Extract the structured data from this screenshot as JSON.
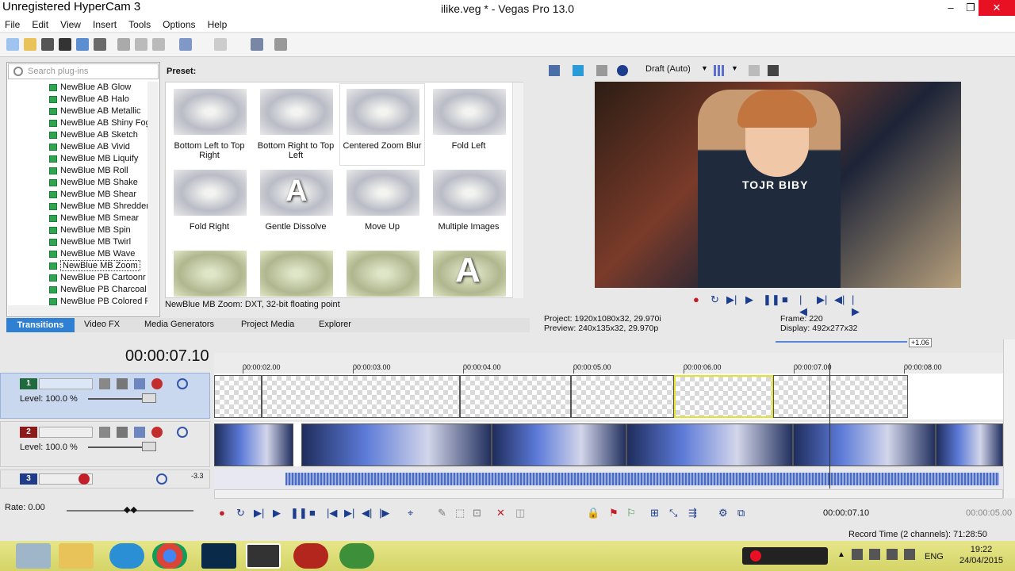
{
  "watermark": "Unregistered HyperCam 3",
  "window": {
    "title": "ilike.veg * - Vegas Pro 13.0",
    "min": "–",
    "max": "❐",
    "close": "✕"
  },
  "menu": [
    "File",
    "Edit",
    "View",
    "Insert",
    "Tools",
    "Options",
    "Help"
  ],
  "search": {
    "placeholder": "Search plug-ins"
  },
  "tree": [
    "NewBlue AB Glow",
    "NewBlue AB Halo",
    "NewBlue AB Metallic",
    "NewBlue AB Shiny Fog",
    "NewBlue AB Sketch",
    "NewBlue AB Vivid",
    "NewBlue MB Liquify",
    "NewBlue MB Roll",
    "NewBlue MB Shake",
    "NewBlue MB Shear",
    "NewBlue MB Shredder",
    "NewBlue MB Smear",
    "NewBlue MB Spin",
    "NewBlue MB Twirl",
    "NewBlue MB Wave",
    "NewBlue MB Zoom",
    "NewBlue PB Cartoonr",
    "NewBlue PB Charcoal",
    "NewBlue PB Colored Pen"
  ],
  "preset_label": "Preset:",
  "presets": [
    "Bottom Left to Top Right",
    "Bottom Right to Top Left",
    "Centered Zoom Blur",
    "Fold Left",
    "Fold Right",
    "Gentle Dissolve",
    "Move Up",
    "Multiple Images"
  ],
  "preset_row3_letter": "A",
  "status": "NewBlue MB Zoom: DXT, 32-bit floating point",
  "tabs": [
    "Transitions",
    "Video FX",
    "Media Generators",
    "Project Media",
    "Explorer"
  ],
  "preview": {
    "quality": "Draft (Auto)",
    "overlay_text": "TOJR BIBY",
    "project": "Project:",
    "project_val": "1920x1080x32, 29.970i",
    "preview": "Preview:",
    "preview_val": "240x135x32, 29.970p",
    "frame": "Frame:",
    "frame_val": "220",
    "display": "Display:",
    "display_val": "492x277x32"
  },
  "timeline": {
    "timecode": "00:00:07.10",
    "ruler": [
      "00:00:02.00",
      "00:00:03.00",
      "00:00:04.00",
      "00:00:05.00",
      "00:00:06.00",
      "00:00:07.00",
      "00:00:08.00"
    ],
    "zoom_badge": "+1.06",
    "tracks": [
      {
        "num": "1",
        "level": "Level: 100.0 %",
        "color": "#1f6b3d"
      },
      {
        "num": "2",
        "level": "Level: 100.0 %",
        "color": "#8b1a1a"
      },
      {
        "num": "3",
        "level": "",
        "color": "#1f3c8b"
      }
    ],
    "audio_db": "-3.3",
    "rate": "Rate: 0.00",
    "cursor_time": "00:00:07.10",
    "end_time": "00:00:05.00",
    "record_time": "Record Time (2 channels): 71:28:50"
  },
  "taskbar": {
    "lang": "ENG",
    "time": "19:22",
    "date": "24/04/2015"
  },
  "colors": {
    "accent": "#2f7fd3",
    "taskbar": "#d9d96f"
  }
}
